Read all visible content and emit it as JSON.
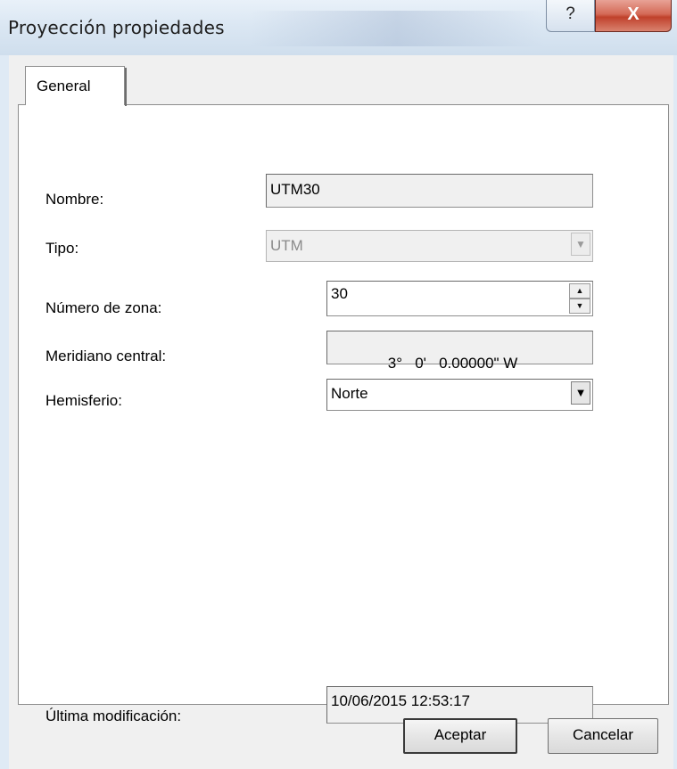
{
  "window": {
    "title": "Proyección propiedades",
    "help_glyph": "?",
    "close_glyph": "X"
  },
  "tabs": [
    {
      "label": "General",
      "selected": true
    }
  ],
  "form": {
    "nombre_label": "Nombre:",
    "nombre_value": "UTM30",
    "tipo_label": "Tipo:",
    "tipo_value": "UTM",
    "zona_label": "Número de zona:",
    "zona_value": "30",
    "meridiano_label": "Meridiano central:",
    "meridiano_value": "3°   0'   0.00000\" W",
    "hemisferio_label": "Hemisferio:",
    "hemisferio_value": "Norte",
    "modificacion_label": "Última modificación:",
    "modificacion_value": "10/06/2015 12:53:17"
  },
  "buttons": {
    "ok": "Aceptar",
    "cancel": "Cancelar"
  },
  "icons": {
    "combo_arrow": "▼",
    "spin_up": "▲",
    "spin_down": "▼"
  }
}
